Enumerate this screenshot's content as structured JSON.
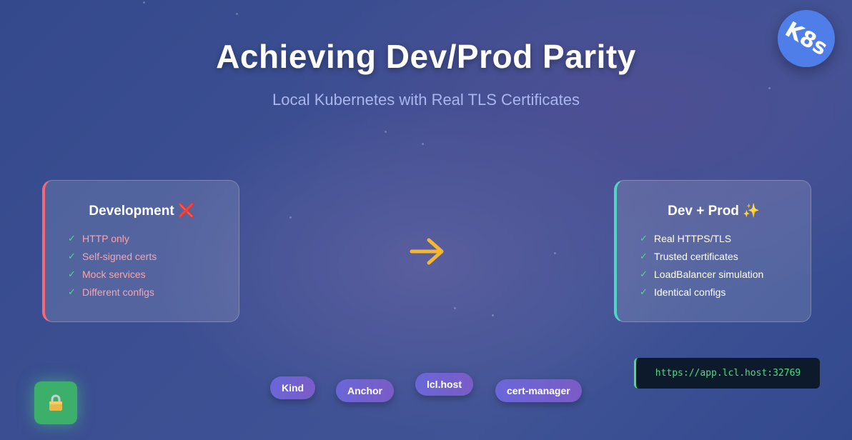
{
  "header": {
    "title": "Achieving Dev/Prod Parity",
    "subtitle": "Local Kubernetes with Real TLS Certificates"
  },
  "badge": {
    "label": "K8s",
    "color": "#4f7ee8"
  },
  "dev_card": {
    "title": "Development",
    "title_icon": "red-x-icon",
    "accent": "#f06a7a",
    "items": [
      "HTTP only",
      "Self-signed certs",
      "Mock services",
      "Different configs"
    ]
  },
  "prod_card": {
    "title": "Dev + Prod",
    "title_icon": "sparkles-icon",
    "accent": "#4fd6c0",
    "items": [
      "Real HTTPS/TLS",
      "Trusted certificates",
      "LoadBalancer simulation",
      "Identical configs"
    ]
  },
  "arrow": {
    "icon": "arrow-right-icon",
    "color": "#f5b731"
  },
  "url": {
    "text": "https://app.lcl.host:32769",
    "color": "#4ade80"
  },
  "tools": [
    "Kind",
    "Anchor",
    "lcl.host",
    "cert-manager"
  ],
  "lock": {
    "icon": "lock-icon",
    "color": "#3cb06b"
  }
}
